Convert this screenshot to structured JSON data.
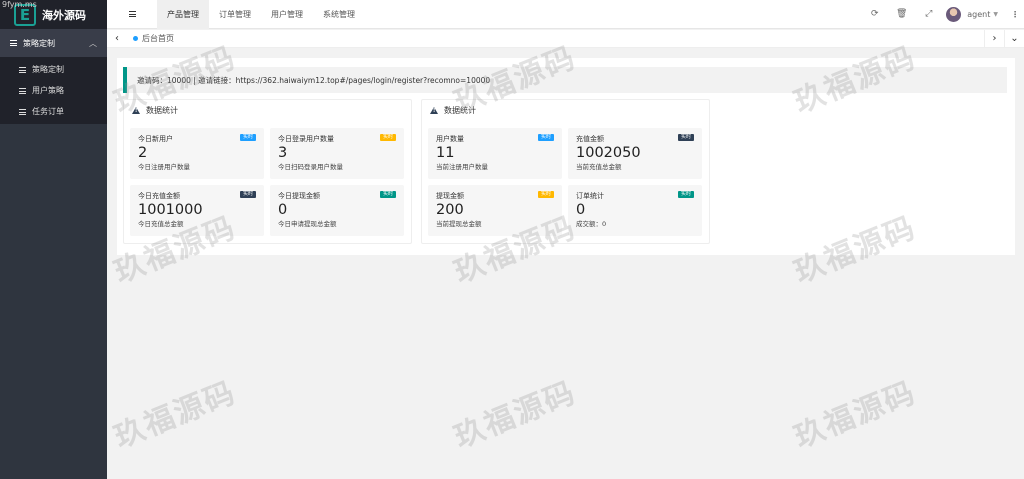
{
  "app": {
    "logo_letter": "E",
    "title": "海外源码",
    "corner_text": "9fym.ms"
  },
  "sidebar": {
    "group_label": "策略定制",
    "items": [
      {
        "label": "策略定制"
      },
      {
        "label": "用户策略"
      },
      {
        "label": "任务订单"
      }
    ]
  },
  "header": {
    "tabs": [
      {
        "label": "产品管理"
      },
      {
        "label": "订单管理"
      },
      {
        "label": "用户管理"
      },
      {
        "label": "系统管理"
      }
    ],
    "user_name": "agent"
  },
  "tabbar": {
    "page_tab": "后台首页"
  },
  "notice": {
    "text": "邀请码：10000 | 邀请链接：https://362.haiwaiym12.top#/pages/login/register?recomno=10000"
  },
  "panels": [
    {
      "title": "数据统计",
      "cards": [
        {
          "label": "今日新用户",
          "value": "2",
          "sub": "今日注册用户数量",
          "badge": "实时",
          "badge_color": "#1e9fff"
        },
        {
          "label": "今日登录用户数量",
          "value": "3",
          "sub": "今日扫码登录用户数量",
          "badge": "实时",
          "badge_color": "#ffb800"
        },
        {
          "label": "今日充值金额",
          "value": "1001000",
          "sub": "今日充值总金额",
          "badge": "实时",
          "badge_color": "#2f4056"
        },
        {
          "label": "今日提现金额",
          "value": "0",
          "sub": "今日申请提现总金额",
          "badge": "实时",
          "badge_color": "#009688"
        }
      ]
    },
    {
      "title": "数据统计",
      "cards": [
        {
          "label": "用户数量",
          "value": "11",
          "sub": "当前注册用户数量",
          "badge": "实时",
          "badge_color": "#1e9fff"
        },
        {
          "label": "充值金额",
          "value": "1002050",
          "sub": "当前充值总金额",
          "badge": "实时",
          "badge_color": "#2f4056"
        },
        {
          "label": "提现金额",
          "value": "200",
          "sub": "当前提现总金额",
          "badge": "实时",
          "badge_color": "#ffb800"
        },
        {
          "label": "订单统计",
          "value": "0",
          "sub": "成交额：0",
          "badge": "实时",
          "badge_color": "#009688"
        }
      ]
    }
  ],
  "watermark": "玖福源码"
}
